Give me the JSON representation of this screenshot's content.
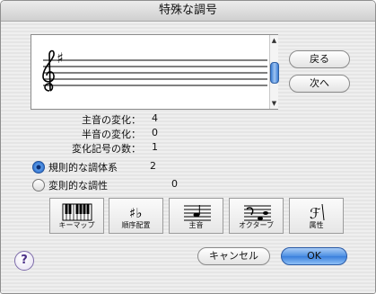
{
  "window": {
    "title": "特殊な調号"
  },
  "staff": {
    "clef": "treble-clef-icon",
    "key_signature": "♯"
  },
  "nav": {
    "back_label": "戻る",
    "next_label": "次へ"
  },
  "info": {
    "tonic_change_label": "主音の変化：",
    "tonic_change_value": "4",
    "semitone_change_label": "半音の変化：",
    "semitone_change_value": "0",
    "accidental_count_label": "変化記号の数：",
    "accidental_count_value": "1"
  },
  "mode": {
    "linear_label": "規則的な調体系",
    "linear_value": "2",
    "linear_selected": true,
    "nonlinear_label": "変則的な調性",
    "nonlinear_value": "0",
    "nonlinear_selected": false
  },
  "tools": [
    {
      "label": "キーマップ",
      "icon": "keyboard-icon"
    },
    {
      "label": "順序配置",
      "icon": "accidental-order-icon"
    },
    {
      "label": "主音",
      "icon": "tonic-icon"
    },
    {
      "label": "オクターブ",
      "icon": "octave-icon"
    },
    {
      "label": "属性",
      "icon": "attributes-icon"
    }
  ],
  "footer": {
    "help_label": "?",
    "cancel_label": "キャンセル",
    "ok_label": "OK"
  },
  "colors": {
    "accent": "#3a7fdc",
    "radio_selected": "#2a69c7"
  }
}
